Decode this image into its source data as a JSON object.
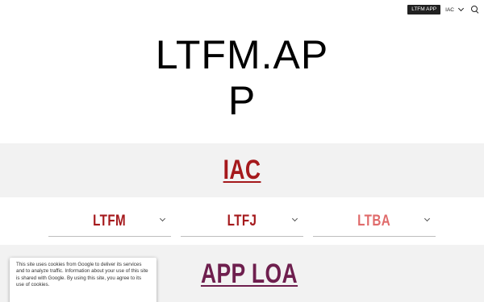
{
  "nav": {
    "app_label": "LTFM APP",
    "iac_label": "IAC",
    "search_icon": "search-icon",
    "chevron_icon": "chevron-down-icon"
  },
  "title": {
    "line1": "LTFM.AP",
    "line2": "P"
  },
  "section_iac": {
    "link_label": "IAC",
    "link_color": "#a5191c",
    "band_color": "#f2f2f2"
  },
  "dropdowns": [
    {
      "label": "LTFM",
      "color": "#a5191c"
    },
    {
      "label": "LTFJ",
      "color": "#a5191c"
    },
    {
      "label": "LTBA",
      "color": "#e06b6b"
    }
  ],
  "section_app": {
    "link_label": "APP LOA",
    "link_color": "#6e1f4e"
  },
  "cookie": {
    "text": "This site uses cookies from Google to deliver its services and to analyze traffic. Information about your use of this site is shared with Google. By using this site, you agree to its use of cookies."
  }
}
